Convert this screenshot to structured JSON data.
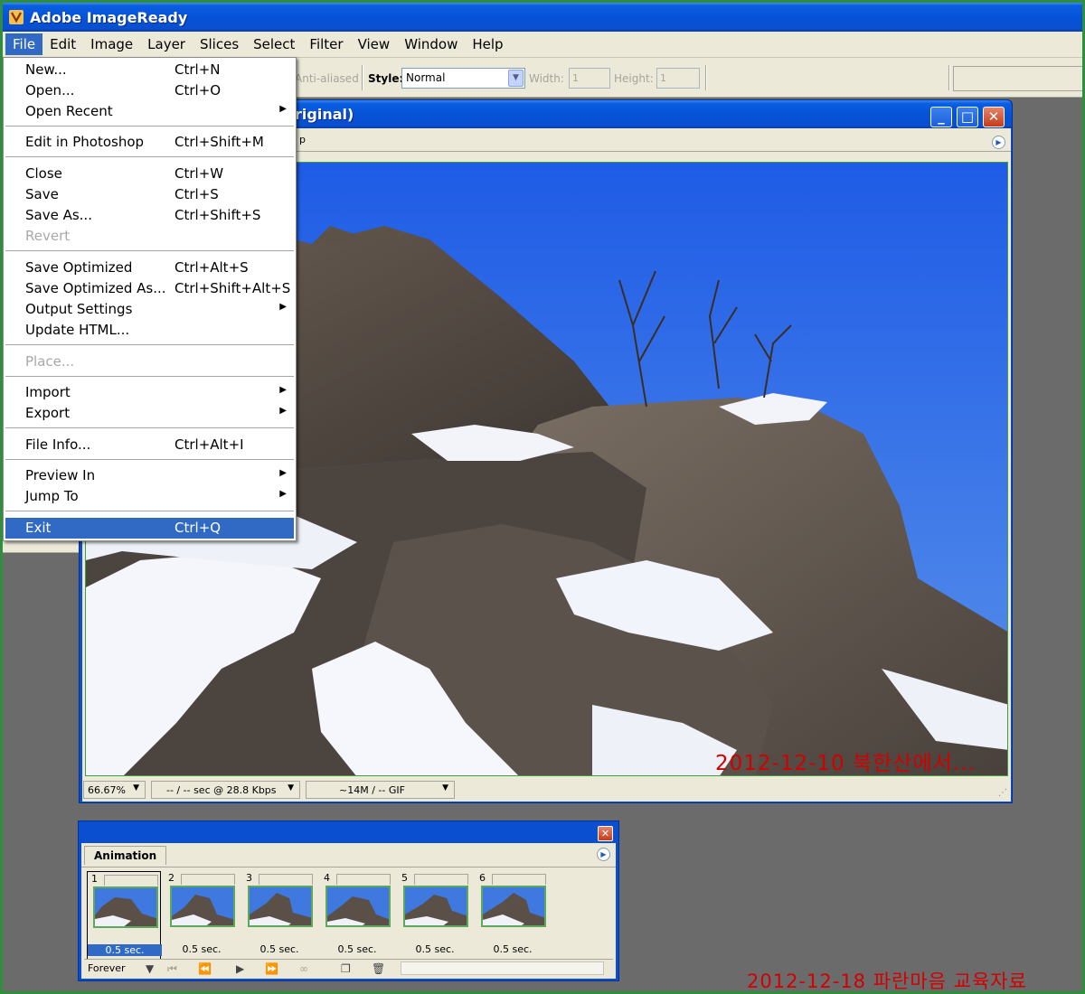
{
  "app": {
    "title": "Adobe ImageReady"
  },
  "menubar": {
    "items": [
      "File",
      "Edit",
      "Image",
      "Layer",
      "Slices",
      "Select",
      "Filter",
      "View",
      "Window",
      "Help"
    ],
    "active": "File"
  },
  "options": {
    "anti_aliased": "Anti-aliased",
    "style_label": "Style:",
    "style_value": "Normal",
    "width_label": "Width:",
    "width_value": "1",
    "height_label": "Height:",
    "height_value": "1"
  },
  "document": {
    "title_fragment": "riginal)",
    "tab_fragment": "p",
    "zoom": "66.67%",
    "download_time": "-- / -- sec @ 28.8 Kbps",
    "size_format": "~14M / -- GIF",
    "watermark": "2012-12-10 북한산에서..."
  },
  "file_menu": {
    "items": [
      {
        "label": "New...",
        "shortcut": "Ctrl+N"
      },
      {
        "label": "Open...",
        "shortcut": "Ctrl+O"
      },
      {
        "label": "Open Recent",
        "submenu": true
      },
      {
        "label": "Edit in Photoshop",
        "shortcut": "Ctrl+Shift+M"
      },
      {
        "label": "Close",
        "shortcut": "Ctrl+W"
      },
      {
        "label": "Save",
        "shortcut": "Ctrl+S"
      },
      {
        "label": "Save As...",
        "shortcut": "Ctrl+Shift+S"
      },
      {
        "label": "Revert",
        "disabled": true
      },
      {
        "label": "Save Optimized",
        "shortcut": "Ctrl+Alt+S"
      },
      {
        "label": "Save Optimized As...",
        "shortcut": "Ctrl+Shift+Alt+S"
      },
      {
        "label": "Output Settings",
        "submenu": true
      },
      {
        "label": "Update HTML..."
      },
      {
        "label": "Place...",
        "disabled": true
      },
      {
        "label": "Import",
        "submenu": true
      },
      {
        "label": "Export",
        "submenu": true
      },
      {
        "label": "File Info...",
        "shortcut": "Ctrl+Alt+I"
      },
      {
        "label": "Preview In",
        "submenu": true
      },
      {
        "label": "Jump To",
        "submenu": true
      },
      {
        "label": "Exit",
        "shortcut": "Ctrl+Q",
        "highlighted": true
      }
    ]
  },
  "animation": {
    "tab": "Animation",
    "frames": [
      {
        "number": "1",
        "delay": "0.5 sec."
      },
      {
        "number": "2",
        "delay": "0.5 sec."
      },
      {
        "number": "3",
        "delay": "0.5 sec."
      },
      {
        "number": "4",
        "delay": "0.5 sec."
      },
      {
        "number": "5",
        "delay": "0.5 sec."
      },
      {
        "number": "6",
        "delay": "0.5 sec."
      }
    ],
    "selected_frame": "1",
    "loop": "Forever"
  },
  "caption": "2012-12-18 파란마음 교육자료",
  "colors": {
    "xp_blue": "#0a4fcf",
    "highlight": "#316ac5",
    "menu_bg": "#ece9d8",
    "caption_red": "#d20000",
    "frame_green": "#2f8f3f"
  }
}
